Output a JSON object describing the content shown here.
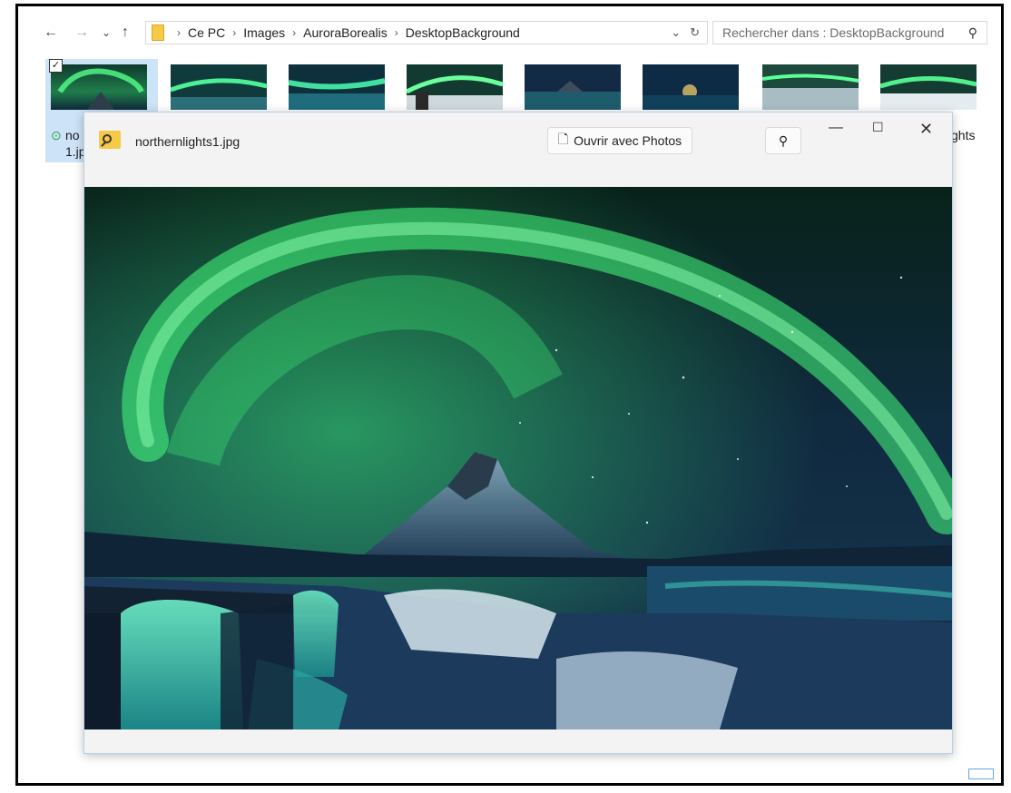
{
  "explorer": {
    "nav": {
      "back": "←",
      "forward": "→",
      "recent": "⌄",
      "up": "↑"
    },
    "breadcrumbs": [
      "Ce PC",
      "Images",
      "AuroraBorealis",
      "DesktopBackground"
    ],
    "search_placeholder": "Rechercher dans : DesktopBackground",
    "thumbnails": {
      "selected_label_line1": "no",
      "selected_label_line2": "1.jp",
      "right_label": "ghts"
    }
  },
  "viewer": {
    "filename": "northernlights1.jpg",
    "open_with_label": "Ouvrir avec Photos"
  },
  "icons": {
    "folder": "folder-icon",
    "search": "search-icon",
    "refresh": "refresh-icon",
    "pin": "pin-icon",
    "minimize": "minimize-icon",
    "maximize": "maximize-icon",
    "close": "close-icon",
    "check": "check-icon"
  },
  "colors": {
    "accent": "#0078d7",
    "aurora": "#39d36b",
    "sky": "#0c1f33"
  }
}
